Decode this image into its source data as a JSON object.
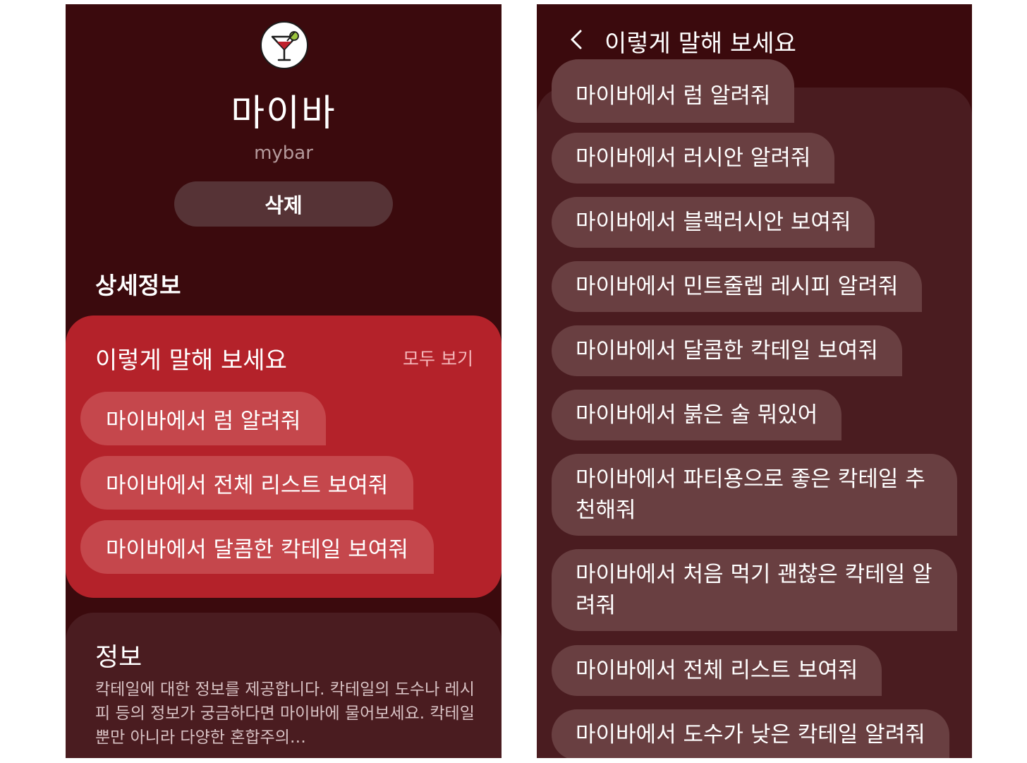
{
  "left_screen": {
    "app_name": "마이바",
    "app_subtitle": "mybar",
    "delete_button": "삭제",
    "section_title": "상세정보",
    "examples_card": {
      "title": "이렇게 말해 보세요",
      "see_all": "모두 보기",
      "chips": [
        "마이바에서 럼 알려줘",
        "마이바에서 전체 리스트 보여줘",
        "마이바에서 달콤한 칵테일 보여줘"
      ]
    },
    "info_card": {
      "title": "정보",
      "description": "칵테일에 대한 정보를 제공합니다. 칵테일의 도수나 레시피 등의 정보가 궁금하다면 마이바에 물어보세요. 칵테일 뿐만 아니라 다양한 혼합주의…"
    }
  },
  "right_screen": {
    "header_title": "이렇게 말해 보세요",
    "utterances": [
      "마이바에서 럼 알려줘",
      "마이바에서 러시안 알려줘",
      "마이바에서 블랙러시안 보여줘",
      "마이바에서 민트줄렙 레시피 알려줘",
      "마이바에서 달콤한 칵테일 보여줘",
      "마이바에서 붉은 술 뭐있어",
      "마이바에서 파티용으로 좋은 칵테일 추천해줘",
      "마이바에서 처음 먹기 괜찮은 칵테일 알려줘",
      "마이바에서 전체 리스트 보여줘",
      "마이바에서 도수가 낮은 칵테일 알려줘"
    ]
  },
  "colors": {
    "background": "#3b0a0d",
    "card_red": "#b4222a",
    "chip_red": "#c5474c",
    "panel": "#4a1c20",
    "chip_dark": "#693f41"
  },
  "icons": [
    "cocktail-icon",
    "back-arrow-icon"
  ]
}
